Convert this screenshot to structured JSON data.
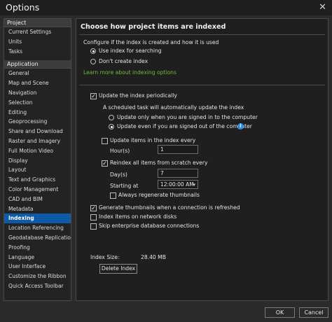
{
  "window": {
    "title": "Options",
    "close_glyph": "✕"
  },
  "sidebar": {
    "project": {
      "header": "Project",
      "items": [
        "Current Settings",
        "Units",
        "Tasks"
      ]
    },
    "application": {
      "header": "Application",
      "items": [
        "General",
        "Map and Scene",
        "Navigation",
        "Selection",
        "Editing",
        "Geoprocessing",
        "Share and Download",
        "Raster and Imagery",
        "Full Motion Video",
        "Display",
        "Layout",
        "Text and Graphics",
        "Color Management",
        "CAD and BIM",
        "Metadata",
        "Indexing",
        "Location Referencing",
        "Geodatabase Replication",
        "Proofing",
        "Language",
        "User Interface",
        "Customize the Ribbon",
        "Quick Access Toolbar"
      ],
      "active": "Indexing"
    }
  },
  "content": {
    "heading": "Choose how project items are indexed",
    "configure_label": "Configure if the index is created and how it is used",
    "radio_use_index": "Use index for searching",
    "radio_dont_create": "Don't create index",
    "learn_more_link": "Learn more about indexing options",
    "update_periodically": "Update the index periodically",
    "scheduled_task_note": "A scheduled task will automatically update the index",
    "radio_signed_in": "Update only when you are signed in to the computer",
    "radio_signed_out": "Update even if you are signed out of the computer",
    "update_items_every": "Update items in the index every",
    "hours_label": "Hour(s)",
    "hours_value": "1",
    "reindex_all": "Reindex all items from scratch every",
    "days_label": "Day(s)",
    "days_value": "7",
    "starting_at_label": "Starting at",
    "starting_at_value": "12:00:00 AM",
    "always_regenerate": "Always regenerate thumbnails",
    "generate_thumbnails": "Generate thumbnails when a connection is refreshed",
    "index_network_disks": "Index items on network disks",
    "skip_enterprise": "Skip enterprise database connections",
    "index_size_label": "Index Size:",
    "index_size_value": "28.40 MB",
    "delete_index_button": "Delete Index"
  },
  "footer": {
    "ok_label": "OK",
    "cancel_label": "Cancel"
  },
  "colors": {
    "accent": "#0e5aa7",
    "link": "#6cbf3c",
    "info": "#2f8fe0"
  }
}
